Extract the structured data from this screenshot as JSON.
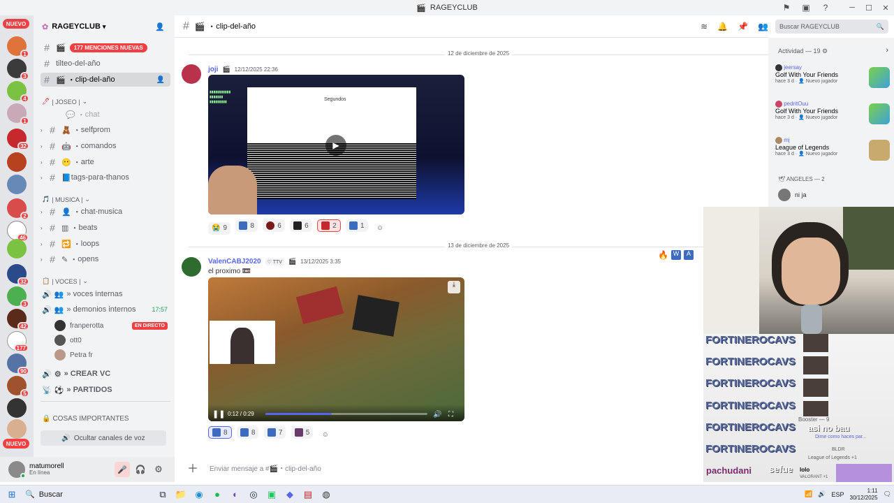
{
  "window": {
    "title": "RAGEYCLUB"
  },
  "servers": {
    "nuevo_top": "NUEVO",
    "nuevo_bottom": "NUEVO",
    "badges": [
      "1",
      "3",
      "4",
      "1",
      "32",
      "2",
      "46",
      "32",
      "3",
      "42",
      "177",
      "90",
      "5"
    ]
  },
  "guild": {
    "name": "RAGEYCLUB",
    "mentions_pill": "177 MENCIONES NUEVAS"
  },
  "channels": {
    "items": [
      {
        "name": "tilteo-del-año"
      },
      {
        "name": "clip-del-año"
      }
    ],
    "cat_joseo": "| JOSEO |",
    "joseo": [
      "chat",
      "selfprom",
      "comandos",
      "arte",
      "tags-para-thanos"
    ],
    "cat_musica": "| MUSICA |",
    "musica": [
      "chat-musica",
      "beats",
      "loops",
      "opens"
    ],
    "cat_voces": "| VOCES |",
    "voces": [
      "» voces internas",
      "» demonios internos"
    ],
    "voice_time": "17:57",
    "voice_users": [
      {
        "name": "franperotta",
        "live": "EN DIRECTO"
      },
      {
        "name": "ott0",
        "live": ""
      },
      {
        "name": "Petra fr",
        "live": ""
      }
    ],
    "crear_vc": "» CREAR VC",
    "partidos": "» PARTIDOS",
    "cat_importantes": "COSAS IMPORTANTES",
    "hide_voice": "Ocultar canales de voz"
  },
  "user": {
    "name": "matumorell",
    "status": "En línea"
  },
  "chat_header": {
    "channel": "clip-del-año",
    "search_placeholder": "Buscar RAGEYCLUB"
  },
  "messages": [
    {
      "date": "12 de diciembre de 2025",
      "author": "joji",
      "timestamp": "12/12/2025 22:36",
      "video_overlay_text": "Segundos",
      "reactions": [
        "9",
        "8",
        "6",
        "6",
        "2",
        "1"
      ]
    },
    {
      "date": "13 de diciembre de 2025",
      "author": "ValenCABJ2020",
      "tag": "TTV",
      "timestamp": "13/12/2025 3:35",
      "text": "el proximo",
      "video_time": "0:12 / 0:29",
      "reactions": [
        "8",
        "8",
        "7",
        "5"
      ]
    }
  ],
  "composer": {
    "placeholder": "Enviar mensaje a #🎬・clip-del-año"
  },
  "activity": {
    "title": "Actividad — 19",
    "items": [
      {
        "user": "jeersay",
        "game": "Golf With Your Friends",
        "meta1": "hace 3 d",
        "meta2": "Nuevo jugador"
      },
      {
        "user": "pedritOuu",
        "game": "Golf With Your Friends",
        "meta1": "hace 3 d",
        "meta2": "Nuevo jugador"
      },
      {
        "user": "mį",
        "game": "League of Legends",
        "meta1": "hace 3 d",
        "meta2": "Nuevo jugador"
      }
    ],
    "angeles": "ANGELES — 2",
    "angeles_user": "ni ja"
  },
  "stream_overlay": {
    "spam_text": "FORTINEROCAVS",
    "chat_msgs": [
      "asi no bau",
      "Dime como haces par...",
      "sefue"
    ],
    "user1": "pachudani",
    "user2": "pachudani",
    "booster": "Booster — 9",
    "lolo": "lolo",
    "lolo_game": "VALORANT +1",
    "bldr": "BLDR",
    "league": "League of Legends +1"
  },
  "taskbar": {
    "search": "Buscar",
    "lang": "ESP",
    "time": "1:11",
    "date": "30/12/2025"
  },
  "colors": {
    "accent": "#5865f2",
    "red": "#f23f43",
    "green": "#23a55a"
  }
}
